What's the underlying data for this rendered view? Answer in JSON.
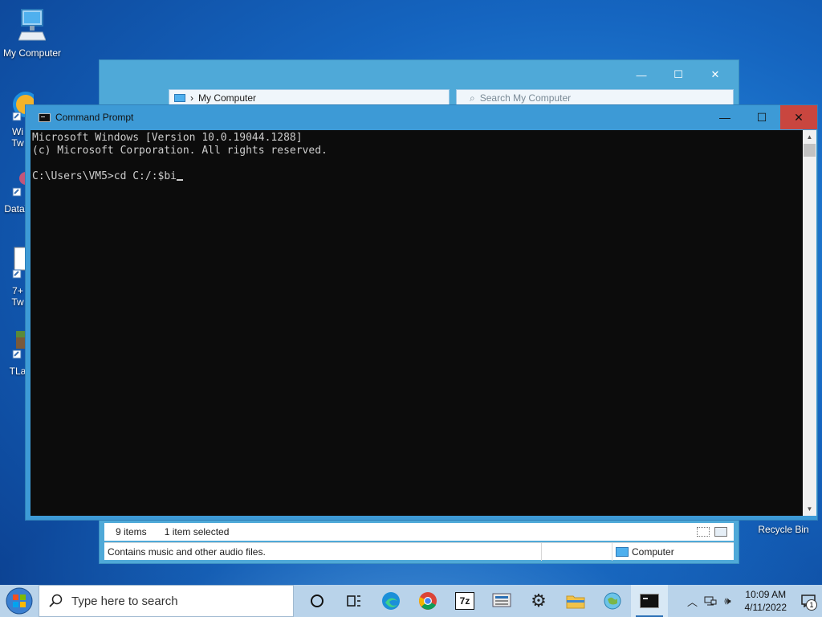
{
  "desktop": {
    "icons": [
      {
        "label": "My Computer"
      },
      {
        "label": "Wi\nTw"
      },
      {
        "label": "DataV"
      },
      {
        "label": "7+\nTw"
      },
      {
        "label": "TLa"
      },
      {
        "label": "Recycle Bin"
      }
    ]
  },
  "explorer": {
    "address": "My Computer",
    "search_placeholder": "Search My Computer",
    "status": {
      "items": "9 items",
      "selected": "1 item selected"
    },
    "details": {
      "description": "Contains music and other audio files.",
      "location": "Computer"
    }
  },
  "cmd": {
    "title": "Command Prompt",
    "lines": [
      "Microsoft Windows [Version 10.0.19044.1288]",
      "(c) Microsoft Corporation. All rights reserved.",
      "",
      "C:\\Users\\VM5>cd C:/:$bi"
    ]
  },
  "taskbar": {
    "search_placeholder": "Type here to search",
    "time": "10:09 AM",
    "date": "4/11/2022",
    "notification_count": "1",
    "apps": [
      "cortana-icon",
      "task-view-icon",
      "edge-icon",
      "chrome-icon",
      "7zip-icon",
      "network-tool-icon",
      "settings-icon",
      "file-explorer-icon",
      "globe-app-icon",
      "command-prompt-icon"
    ]
  },
  "colors": {
    "console_bg": "#0c0c0c",
    "console_fg": "#cccccc",
    "title_active": "#3d9ad6",
    "close_button": "#c9463f"
  }
}
